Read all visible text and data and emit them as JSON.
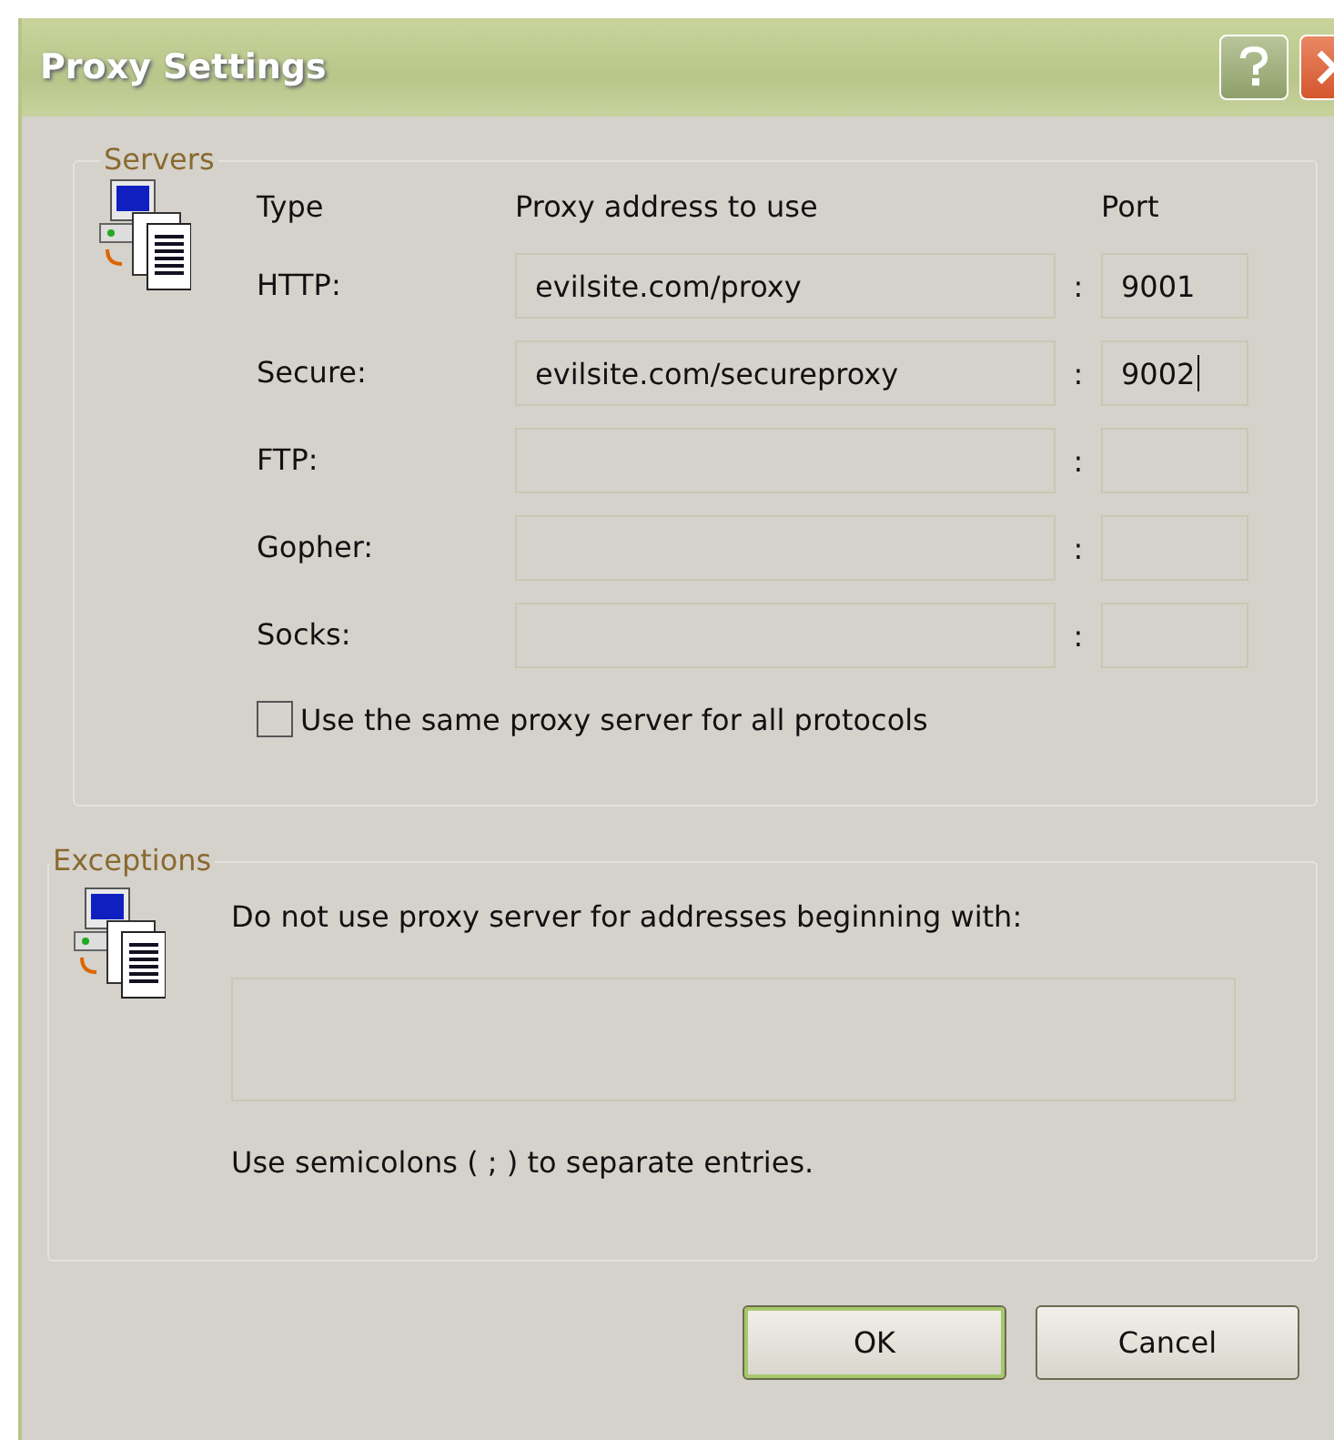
{
  "window": {
    "title": "Proxy Settings"
  },
  "servers": {
    "title": "Servers",
    "columns": [
      "Type",
      "Proxy address to use",
      "Port"
    ],
    "rows": [
      {
        "label": "HTTP:",
        "address": "evilsite.com/proxy",
        "port": "9001",
        "focused": false
      },
      {
        "label": "Secure:",
        "address": "evilsite.com/secureproxy",
        "port": "9002",
        "focused": true
      },
      {
        "label": "FTP:",
        "focused": false
      },
      {
        "label": "Gopher:",
        "focused": false
      },
      {
        "label": "Socks:",
        "focused": false
      }
    ],
    "separator": ":",
    "same_proxy": {
      "label": "Use the same proxy server for all protocols",
      "checked": false
    }
  },
  "exceptions": {
    "title": "Exceptions",
    "prompt": "Do not use proxy server for addresses beginning with:",
    "hint": "Use semicolons ( ; ) to separate entries."
  },
  "buttons": [
    {
      "label": "OK",
      "default": true
    },
    {
      "label": "Cancel",
      "default": false
    }
  ]
}
